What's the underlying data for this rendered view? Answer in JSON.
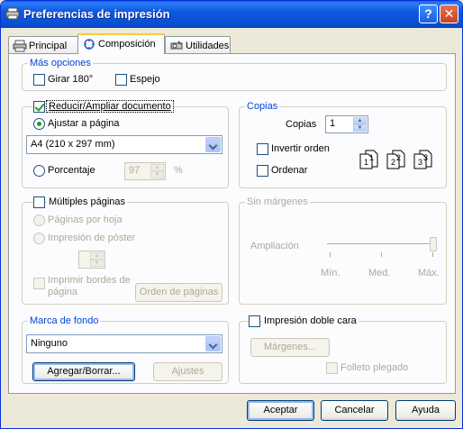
{
  "window": {
    "title": "Preferencias de impresión"
  },
  "titlebar": {
    "help_glyph": "?",
    "close_glyph": "✕"
  },
  "tabs": [
    {
      "label": "Principal",
      "icon": "printer-icon"
    },
    {
      "label": "Composición",
      "icon": "layout-icon"
    },
    {
      "label": "Utilidades",
      "icon": "tools-icon"
    }
  ],
  "mas_opciones": {
    "title": "Más opciones",
    "girar_label": "Girar 180°",
    "girar_checked": false,
    "espejo_label": "Espejo",
    "espejo_checked": false
  },
  "reducir": {
    "label": "Reducir/Ampliar documento",
    "checked": true,
    "ajustar_label": "Ajustar a página",
    "ajustar_selected": true,
    "paper_value": "A4 (210 x 297 mm)",
    "porcentaje_label": "Porcentaje",
    "porcentaje_value": "97",
    "percent_sign": "%"
  },
  "copias": {
    "title": "Copias",
    "copias_label": "Copias",
    "copias_value": "1",
    "invertir_label": "Invertir orden",
    "invertir_checked": false,
    "ordenar_label": "Ordenar",
    "ordenar_checked": false,
    "collate_digits": [
      "1",
      "1",
      "2",
      "2",
      "3",
      "3"
    ]
  },
  "multiples": {
    "label": "Múltiples páginas",
    "checked": false,
    "paginas_por_hoja_label": "Páginas por hoja",
    "impresion_poster_label": "Impresión de póster",
    "imprimir_bordes_label_1": "Imprimir bordes de",
    "imprimir_bordes_label_2": "página",
    "orden_paginas_button": "Orden de páginas"
  },
  "sin_margenes": {
    "title": "Sin márgenes",
    "ampliacion_label": "Ampliación",
    "ticks": [
      "Mín.",
      "Med.",
      "Máx."
    ],
    "level": "Máx."
  },
  "marca_fondo": {
    "title": "Marca de fondo",
    "value": "Ninguno",
    "agregar_button": "Agregar/Borrar...",
    "ajustes_button": "Ajustes"
  },
  "doble_cara": {
    "label": "Impresión doble cara",
    "checked": false,
    "margenes_button": "Márgenes...",
    "folleto_label": "Folleto plegado"
  },
  "footer": {
    "aceptar": "Aceptar",
    "cancelar": "Cancelar",
    "ayuda": "Ayuda"
  }
}
